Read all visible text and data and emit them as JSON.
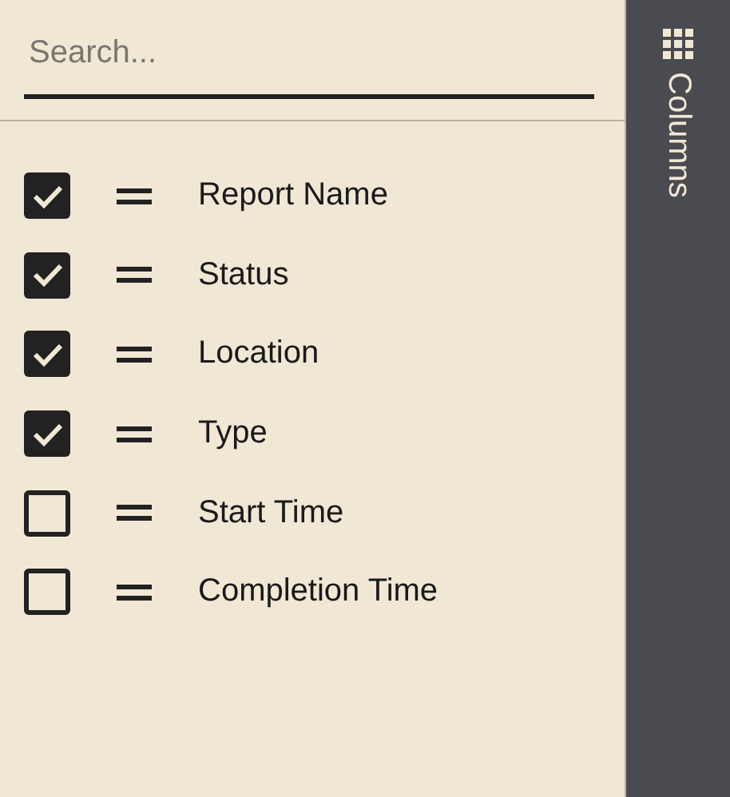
{
  "search": {
    "placeholder": "Search..."
  },
  "columns": [
    {
      "label": "Report Name",
      "checked": true
    },
    {
      "label": "Status",
      "checked": true
    },
    {
      "label": "Location",
      "checked": true
    },
    {
      "label": "Type",
      "checked": true
    },
    {
      "label": "Start Time",
      "checked": false
    },
    {
      "label": "Completion Time",
      "checked": false
    }
  ],
  "side_bar": {
    "tabs": [
      {
        "label": "Columns",
        "selected": true
      }
    ]
  }
}
